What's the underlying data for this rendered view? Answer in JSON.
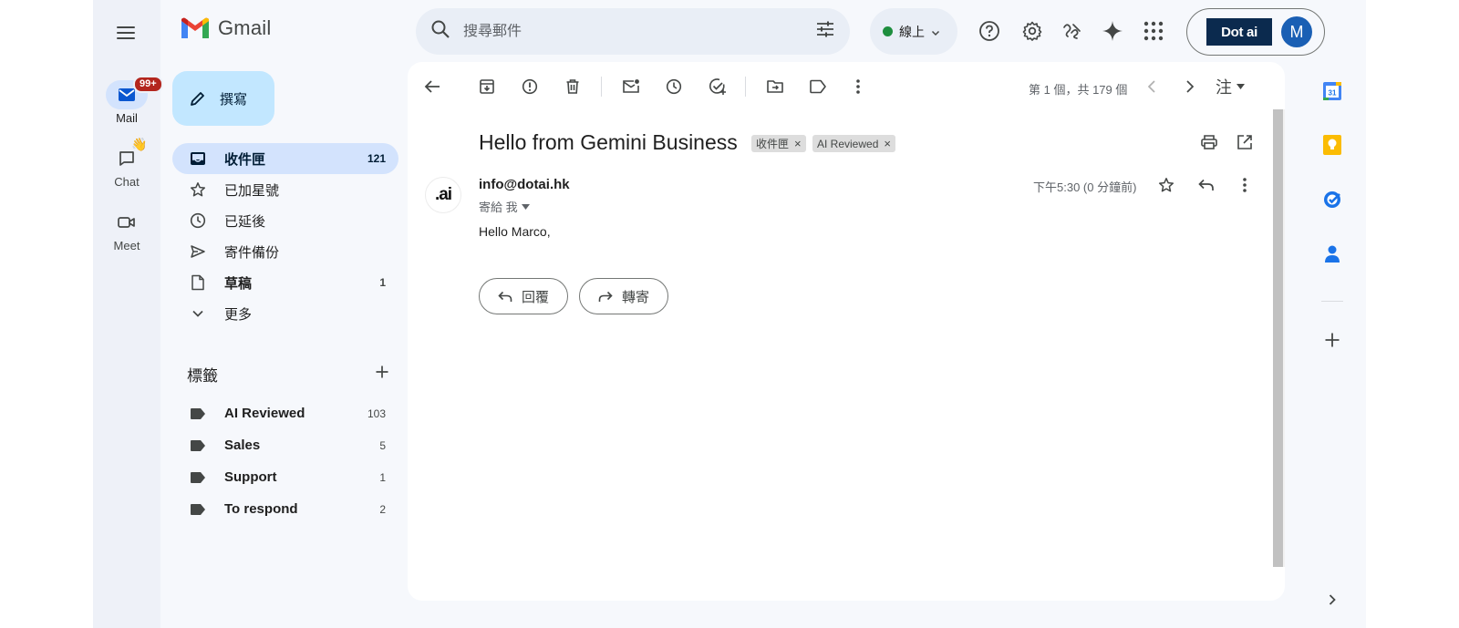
{
  "rail": {
    "mail_label": "Mail",
    "mail_badge": "99+",
    "chat_label": "Chat",
    "meet_label": "Meet"
  },
  "brand": {
    "name": "Gmail"
  },
  "compose": {
    "label": "撰寫"
  },
  "nav": {
    "items": [
      {
        "label": "收件匣",
        "count": "121",
        "icon": "inbox-icon"
      },
      {
        "label": "已加星號",
        "count": "",
        "icon": "star-icon"
      },
      {
        "label": "已延後",
        "count": "",
        "icon": "clock-icon"
      },
      {
        "label": "寄件備份",
        "count": "",
        "icon": "send-icon"
      },
      {
        "label": "草稿",
        "count": "1",
        "icon": "draft-icon"
      },
      {
        "label": "更多",
        "count": "",
        "icon": "chevron-down-icon"
      }
    ]
  },
  "labels": {
    "title": "標籤",
    "items": [
      {
        "label": "AI Reviewed",
        "count": "103"
      },
      {
        "label": "Sales",
        "count": "5"
      },
      {
        "label": "Support",
        "count": "1"
      },
      {
        "label": "To respond",
        "count": "2"
      }
    ]
  },
  "search": {
    "placeholder": "搜尋郵件"
  },
  "status": {
    "label": "線上",
    "color": "#1e8e3e"
  },
  "account": {
    "brand_logo": "Dot ai",
    "avatar_initial": "M"
  },
  "toolbar": {
    "pager": "第 1 個，共 179 個",
    "lang_label": "注"
  },
  "email": {
    "subject": "Hello from Gemini Business",
    "chips": [
      "收件匣",
      "AI Reviewed"
    ],
    "sender_avatar": ".ai",
    "sender": "info@dotai.hk",
    "recipient": "寄給 我",
    "time": "下午5:30 (0 分鐘前)",
    "body": "Hello Marco,",
    "reply_label": "回覆",
    "forward_label": "轉寄"
  },
  "colors": {
    "accent": "#0b57d0",
    "nav_active": "#d3e3fd",
    "compose": "#c2e7ff",
    "badge": "#b3261e"
  }
}
